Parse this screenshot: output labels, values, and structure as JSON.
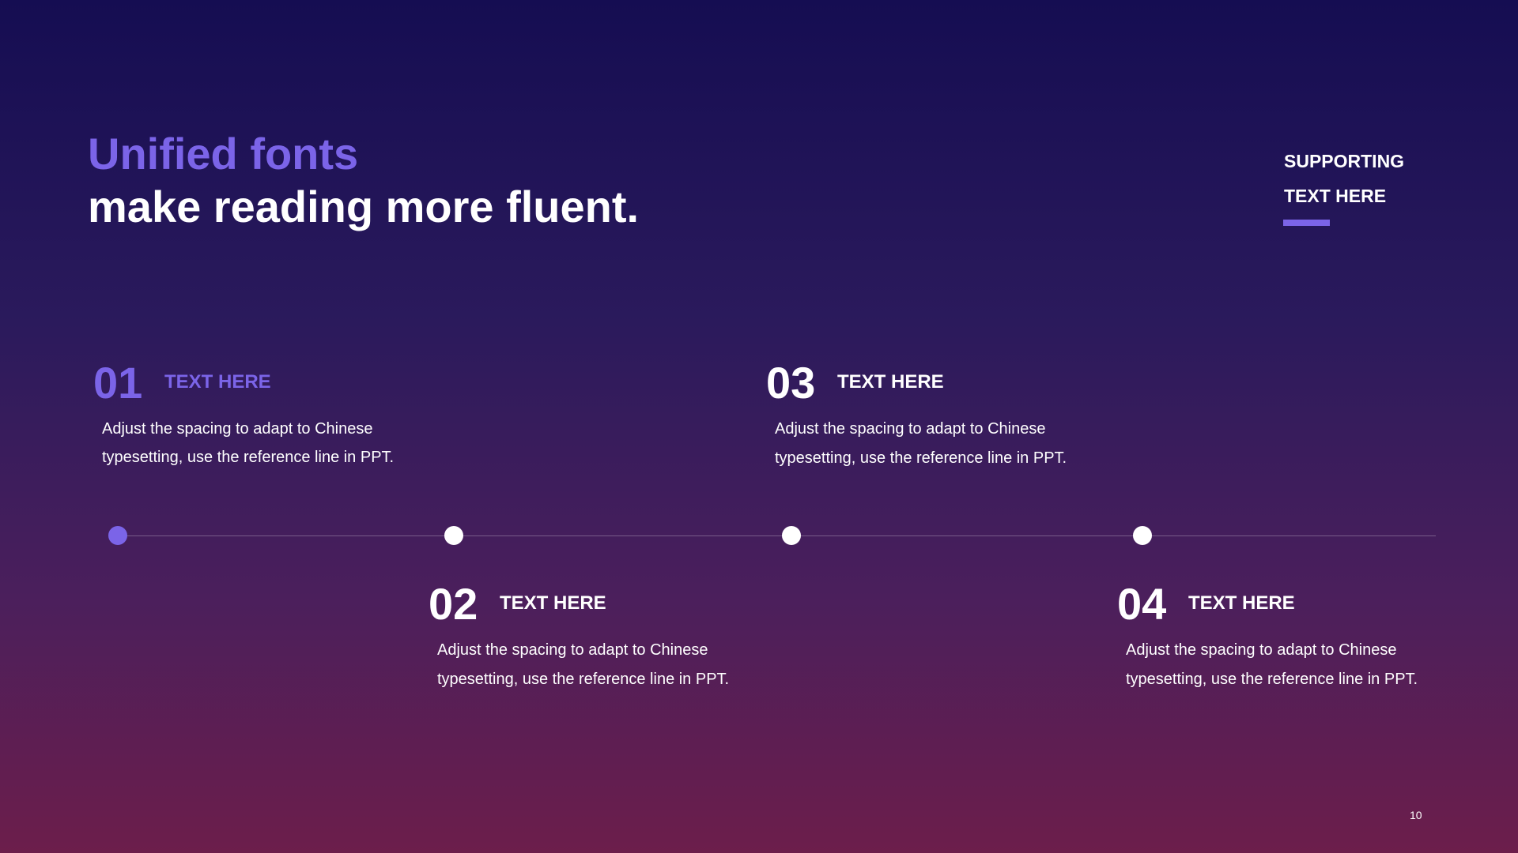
{
  "title": {
    "line1": "Unified fonts",
    "line2": "make reading more fluent."
  },
  "supporting": {
    "line1": "SUPPORTING",
    "line2": "TEXT HERE"
  },
  "steps": [
    {
      "number": "01",
      "heading": "TEXT HERE",
      "desc_line1": "Adjust the spacing to adapt to Chinese",
      "desc_line2": "typesetting, use the reference line in PPT."
    },
    {
      "number": "02",
      "heading": "TEXT HERE",
      "desc_line1": "Adjust the spacing to adapt to Chinese",
      "desc_line2": "typesetting, use the reference line in PPT."
    },
    {
      "number": "03",
      "heading": "TEXT HERE",
      "desc_line1": "Adjust the spacing to adapt to Chinese",
      "desc_line2": "typesetting, use the reference line in PPT."
    },
    {
      "number": "04",
      "heading": "TEXT HERE",
      "desc_line1": "Adjust the spacing to adapt to Chinese",
      "desc_line2": "typesetting, use the reference line in PPT."
    }
  ],
  "page_number": "10",
  "colors": {
    "accent": "#7b64e8",
    "background_top": "#150d52",
    "background_bottom": "#6c1e4b",
    "text": "#ffffff"
  }
}
